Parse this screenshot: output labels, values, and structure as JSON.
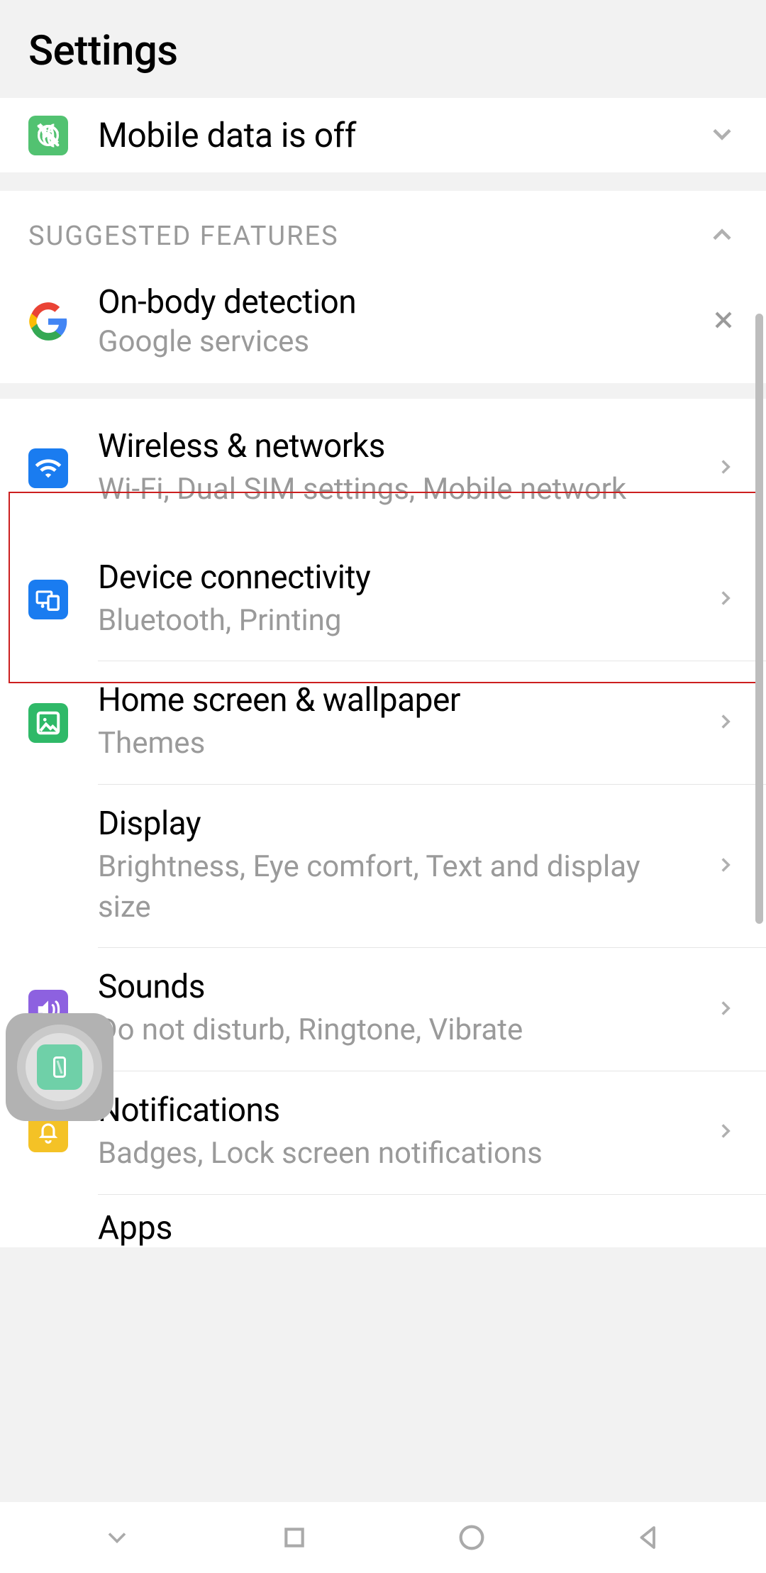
{
  "header": {
    "title": "Settings"
  },
  "status": {
    "label": "Mobile data is off"
  },
  "suggested": {
    "header": "SUGGESTED FEATURES",
    "item": {
      "title": "On-body detection",
      "desc": "Google services"
    }
  },
  "items": {
    "wireless": {
      "title": "Wireless & networks",
      "desc": "Wi-Fi, Dual SIM settings, Mobile network"
    },
    "device": {
      "title": "Device connectivity",
      "desc": "Bluetooth, Printing"
    },
    "home": {
      "title": "Home screen & wallpaper",
      "desc": "Themes"
    },
    "display": {
      "title": "Display",
      "desc": "Brightness, Eye comfort, Text and display size"
    },
    "sounds": {
      "title": "Sounds",
      "desc": "Do not disturb, Ringtone, Vibrate"
    },
    "notif": {
      "title": "Notifications",
      "desc": "Badges, Lock screen notifications"
    },
    "apps": {
      "title": "Apps"
    }
  }
}
